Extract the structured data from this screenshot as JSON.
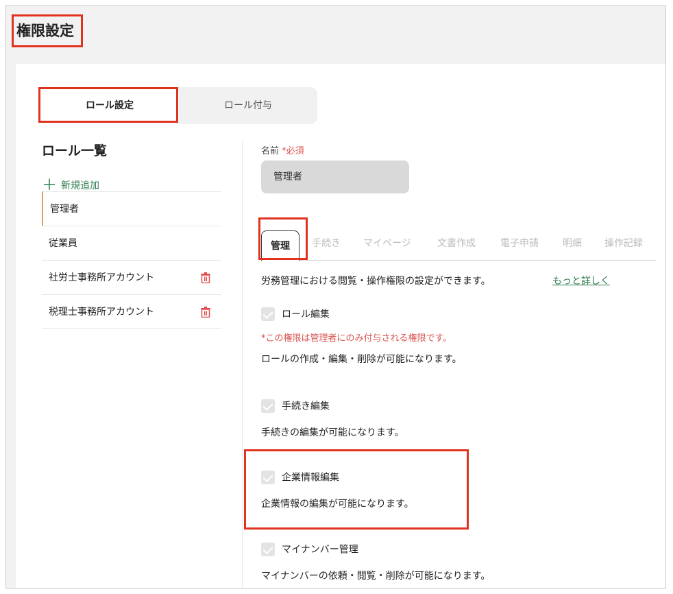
{
  "page": {
    "title": "権限設定"
  },
  "mode_tabs": {
    "role_settings": "ロール設定",
    "role_assignment": "ロール付与"
  },
  "role_list": {
    "title": "ロール一覧",
    "add_label": "新規追加",
    "items": [
      {
        "label": "管理者",
        "selected": true,
        "deletable": false
      },
      {
        "label": "従業員",
        "selected": false,
        "deletable": false
      },
      {
        "label": "社労士事務所アカウント",
        "selected": false,
        "deletable": true
      },
      {
        "label": "税理士事務所アカウント",
        "selected": false,
        "deletable": true
      }
    ]
  },
  "name_field": {
    "label": "名前",
    "required": "*必須",
    "value": "管理者"
  },
  "perm_tabs": [
    "管理",
    "手続き",
    "マイページ",
    "文書作成",
    "電子申請",
    "明細",
    "操作記録"
  ],
  "perm_section": {
    "description": "労務管理における閲覧・操作権限の設定ができます。",
    "more_link": "もっと詳しく",
    "items": [
      {
        "name": "ロール編集",
        "note": "*この権限は管理者にのみ付与される権限です。",
        "text": "ロールの作成・編集・削除が可能になります。"
      },
      {
        "name": "手続き編集",
        "note": "",
        "text": "手続きの編集が可能になります。"
      },
      {
        "name": "企業情報編集",
        "note": "",
        "text": "企業情報の編集が可能になります。"
      },
      {
        "name": "マイナンバー管理",
        "note": "",
        "text": "マイナンバーの依頼・閲覧・削除が可能になります。"
      }
    ]
  },
  "colors": {
    "highlight": "#e0321e",
    "accent_green": "#2e7d4f",
    "required_red": "#d9534f"
  }
}
